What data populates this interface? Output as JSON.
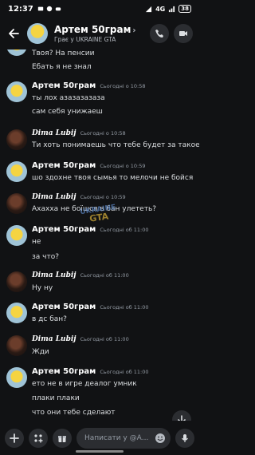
{
  "status_bar": {
    "time": "12:37",
    "network": "4G",
    "battery": "38"
  },
  "header": {
    "name": "Артем 50грам",
    "status": "Грає у UKRAINE GTA"
  },
  "messages": [
    {
      "author": "",
      "time": "",
      "lines": [
        "Твоя? На пенсии",
        "Ебать я не знал"
      ]
    },
    {
      "author": "Артем 50грам",
      "time": "Сьогодні о 10:58",
      "lines": [
        "ты лох азазазазаза",
        "сам себя унижаеш"
      ]
    },
    {
      "author": "Dima Lubij",
      "time": "Сьогодні о 10:58",
      "lines": [
        "Ти хоть понимаешь что тебе будет за такое?"
      ]
    },
    {
      "author": "Артем 50грам",
      "time": "Сьогодні о 10:59",
      "lines": [
        "шо здохне твоя сымья то мелочи не бойся"
      ]
    },
    {
      "author": "Dima Lubij",
      "time": "Сьогодні о 10:59",
      "lines": [
        "Ахахха не боїшся в бан улететь?"
      ]
    },
    {
      "author": "Артем 50грам",
      "time": "Сьогодні об 11:00",
      "lines": [
        "не",
        "за что?"
      ]
    },
    {
      "author": "Dima Lubij",
      "time": "Сьогодні об 11:00",
      "lines": [
        "Ну ну"
      ]
    },
    {
      "author": "Артем 50грам",
      "time": "Сьогодні об 11:00",
      "lines": [
        "в дс бан?"
      ]
    },
    {
      "author": "Dima Lubij",
      "time": "Сьогодні об 11:00",
      "lines": [
        "Жди"
      ]
    },
    {
      "author": "Артем 50грам",
      "time": "Сьогодні об 11:00",
      "lines": [
        "ето не в игре деалог умник",
        "плаки плаки",
        "что они тебе сделают"
      ]
    }
  ],
  "watermark": {
    "line1": "UKRAINE",
    "line2": "GTA"
  },
  "input": {
    "placeholder": "Написати у @А..."
  },
  "colors": {
    "background": "#111214",
    "surface": "#2b2d31",
    "text": "#dbdee1",
    "muted": "#949ba4"
  }
}
